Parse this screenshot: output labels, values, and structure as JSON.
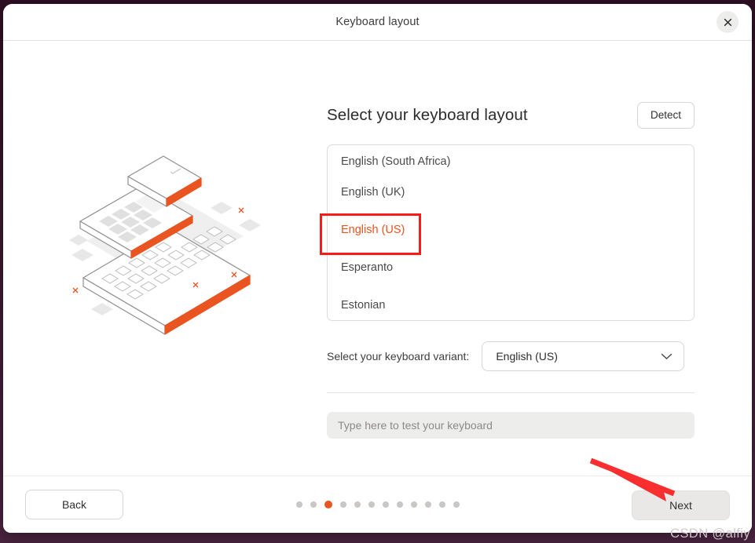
{
  "window": {
    "title": "Keyboard layout",
    "close_icon": "close-icon"
  },
  "main": {
    "page_title": "Select your keyboard layout",
    "detect_label": "Detect",
    "layout_options": [
      {
        "label": "English (South Africa)",
        "selected": false
      },
      {
        "label": "English (UK)",
        "selected": false
      },
      {
        "label": "English (US)",
        "selected": true
      },
      {
        "label": "Esperanto",
        "selected": false
      },
      {
        "label": "Estonian",
        "selected": false
      }
    ],
    "variant_label": "Select your keyboard variant:",
    "variant_value": "English (US)",
    "variant_chevron_icon": "chevron-down-icon",
    "test_placeholder": "Type here to test your keyboard",
    "test_value": ""
  },
  "footer": {
    "back_label": "Back",
    "next_label": "Next",
    "total_steps": 12,
    "active_step": 3
  },
  "annotations": {
    "watermark": "CSDN @alfiy",
    "highlight_color": "#fa1a1a",
    "arrow_color": "#f92f2f"
  },
  "colors": {
    "accent": "#e95420",
    "desktop_background": "#3a1b30",
    "selected_text": "#e95420"
  },
  "illustration": {
    "name": "isometric-keyboard-layers-illustration",
    "accent": "#e95420",
    "outline": "#8c8c8c",
    "fill": "#ffffff",
    "shadow": "#e3e3e3"
  }
}
